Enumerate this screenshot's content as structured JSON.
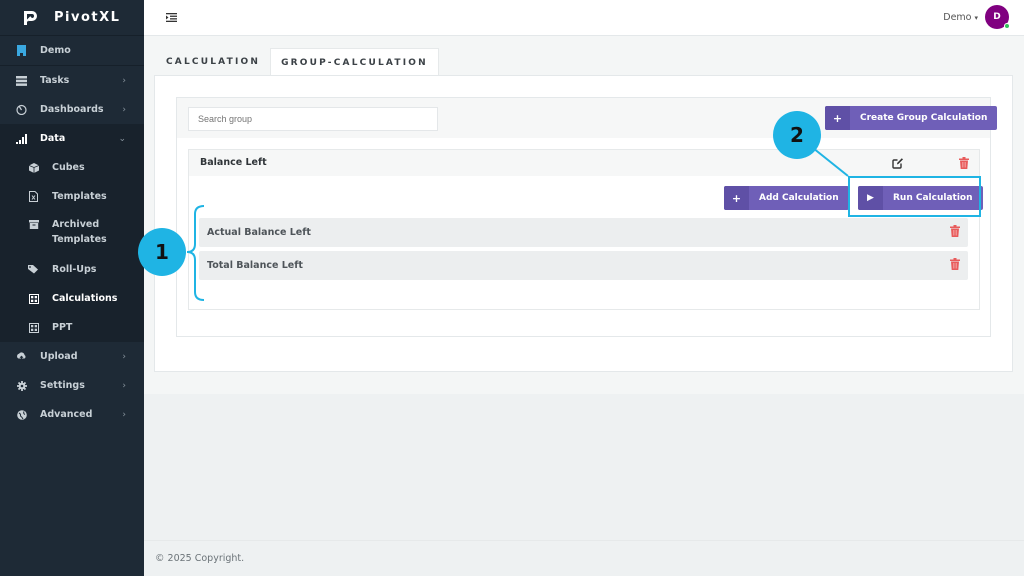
{
  "app": {
    "name": "PivotXL"
  },
  "sidebar": {
    "items": [
      {
        "label": "Demo",
        "icon": "building-icon"
      },
      {
        "label": "Tasks",
        "icon": "server-icon",
        "chevron": "›"
      },
      {
        "label": "Dashboards",
        "icon": "dashboard-icon",
        "chevron": "›"
      },
      {
        "label": "Data",
        "icon": "bar-chart-icon",
        "chevron": "⌄"
      },
      {
        "label": "Upload",
        "icon": "cloud-upload-icon",
        "chevron": "›"
      },
      {
        "label": "Settings",
        "icon": "gear-icon",
        "chevron": "›"
      },
      {
        "label": "Advanced",
        "icon": "globe-icon",
        "chevron": "›"
      }
    ],
    "data_children": [
      {
        "label": "Cubes",
        "icon": "cube-icon"
      },
      {
        "label": "Templates",
        "icon": "excel-file-icon"
      },
      {
        "label": "Archived Templates",
        "icon": "archive-icon"
      },
      {
        "label": "Roll-Ups",
        "icon": "tags-icon"
      },
      {
        "label": "Calculations",
        "icon": "calculator-icon",
        "active": true
      },
      {
        "label": "PPT",
        "icon": "calculator-icon"
      }
    ]
  },
  "topbar": {
    "user_name": "Demo",
    "user_caret": "▾",
    "avatar_initial": "D",
    "avatar_color": "#800080",
    "online_color": "#31c15a"
  },
  "tabs": [
    {
      "label": "CALCULATION",
      "active": false
    },
    {
      "label": "GROUP-CALCULATION",
      "active": true
    }
  ],
  "search": {
    "placeholder": "Search group",
    "value": ""
  },
  "buttons": {
    "create_group": "Create Group Calculation",
    "add_calculation": "Add Calculation",
    "run_calculation": "Run Calculation",
    "plus_glyph": "+",
    "play_glyph": "▶"
  },
  "group": {
    "title": "Balance Left",
    "calculations": [
      {
        "label": "Actual Balance Left"
      },
      {
        "label": "Total Balance Left"
      }
    ]
  },
  "annotations": {
    "badge1": "1",
    "badge2": "2",
    "color": "#1fb4e4"
  },
  "colors": {
    "sidebar_bg": "#1e2a36",
    "button_purple": "#6f5fb8",
    "delete_red": "#e85b5b"
  },
  "footer": {
    "copyright": "© 2025 Copyright."
  }
}
